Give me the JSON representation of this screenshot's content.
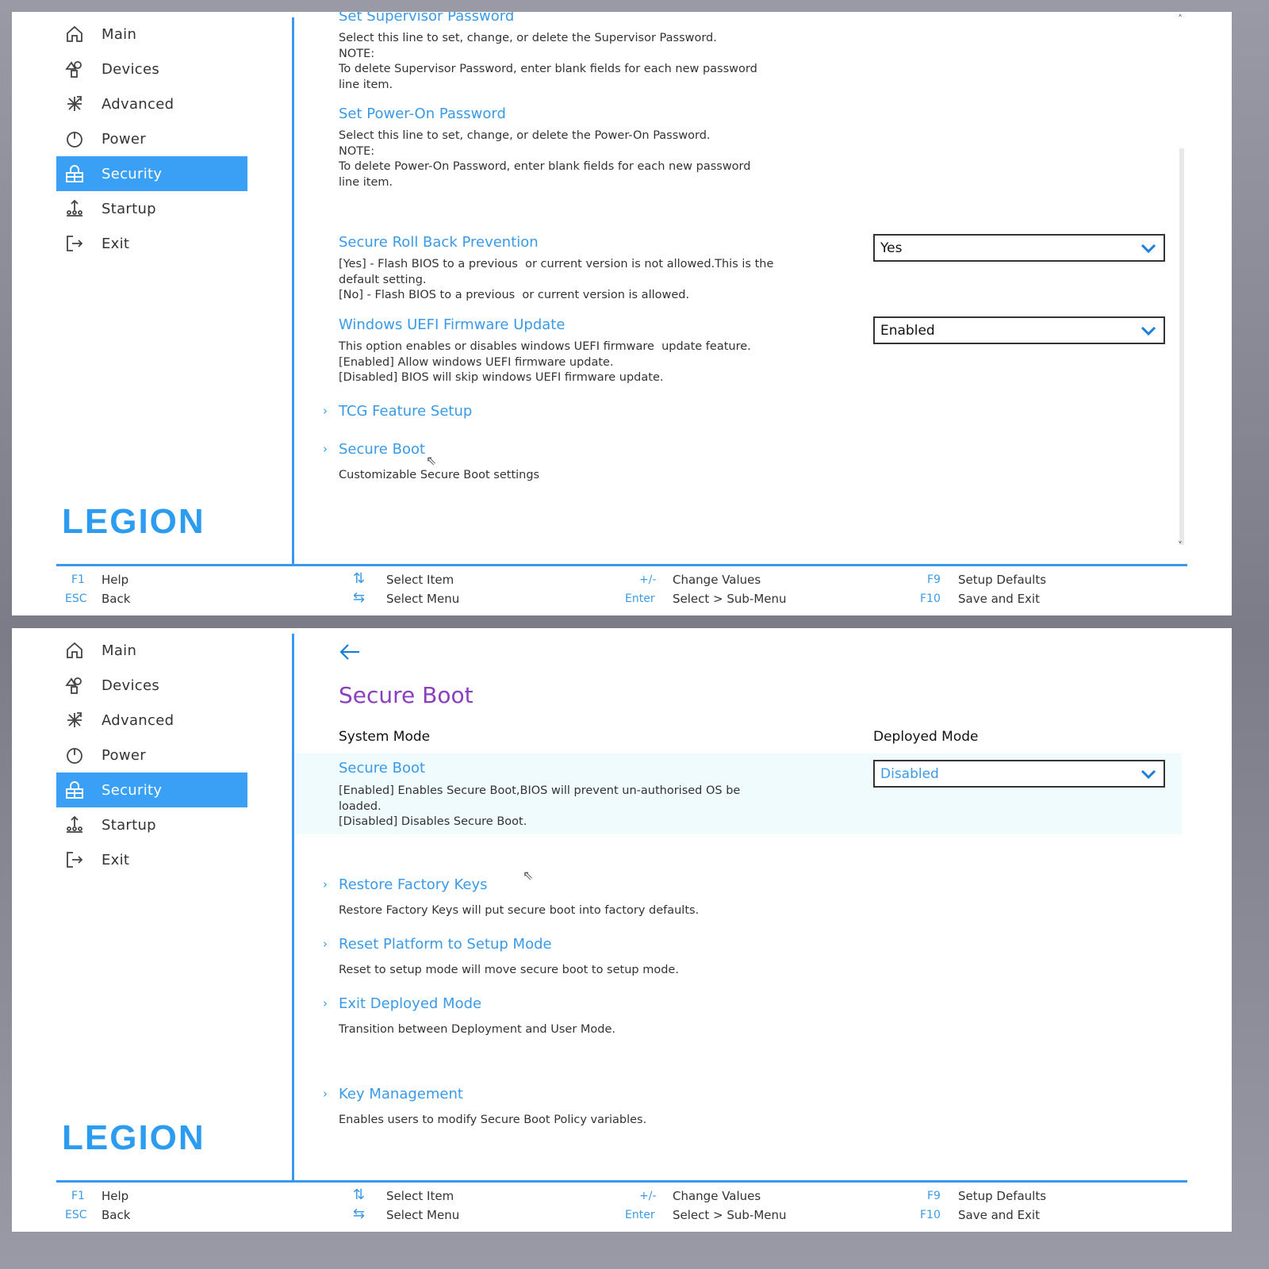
{
  "sidebar": {
    "items": [
      {
        "label": "Main",
        "icon": "home-icon"
      },
      {
        "label": "Devices",
        "icon": "devices-icon"
      },
      {
        "label": "Advanced",
        "icon": "advanced-icon"
      },
      {
        "label": "Power",
        "icon": "power-icon"
      },
      {
        "label": "Security",
        "icon": "lock-icon",
        "selected": true
      },
      {
        "label": "Startup",
        "icon": "startup-icon"
      },
      {
        "label": "Exit",
        "icon": "exit-icon"
      }
    ],
    "logo": "LEGION"
  },
  "footer": {
    "f1": "F1",
    "help": "Help",
    "esc": "ESC",
    "back": "Back",
    "select_item": "Select Item",
    "select_menu": "Select Menu",
    "plusminus": "+/-",
    "change_values": "Change Values",
    "enter": "Enter",
    "sub_menu": "Select > Sub-Menu",
    "f9": "F9",
    "defaults": "Setup Defaults",
    "f10": "F10",
    "save_exit": "Save and Exit"
  },
  "panel1": {
    "supervisor": {
      "title": "Set Supervisor Password",
      "desc": "Select this line to set, change, or delete the Supervisor Password.\nNOTE:\nTo delete Supervisor Password, enter blank fields for each new password\nline item."
    },
    "poweron": {
      "title": "Set Power-On Password",
      "desc": "Select this line to set, change, or delete the Power-On Password.\nNOTE:\nTo delete Power-On Password, enter blank fields for each new password\nline item."
    },
    "rollback": {
      "title": "Secure Roll Back Prevention",
      "desc": "[Yes] - Flash BIOS to a previous  or current version is not allowed.This is the\ndefault setting.\n[No] - Flash BIOS to a previous  or current version is allowed.",
      "value": "Yes"
    },
    "uefi": {
      "title": "Windows UEFI Firmware Update",
      "desc": "This option enables or disables windows UEFI firmware  update feature.\n[Enabled] Allow windows UEFI firmware update.\n[Disabled] BIOS will skip windows UEFI firmware update.",
      "value": "Enabled"
    },
    "tcg": {
      "title": "TCG Feature Setup"
    },
    "secureboot": {
      "title": "Secure Boot",
      "desc": "Customizable Secure Boot settings"
    }
  },
  "panel2": {
    "title": "Secure Boot",
    "system_mode_label": "System Mode",
    "system_mode_value": "Deployed Mode",
    "secureboot": {
      "title": "Secure Boot",
      "desc": "[Enabled] Enables Secure Boot,BIOS will prevent un-authorised OS be\nloaded.\n[Disabled] Disables Secure Boot.",
      "value": "Disabled"
    },
    "restore": {
      "title": "Restore Factory Keys",
      "desc": "Restore Factory Keys will put secure boot into factory defaults."
    },
    "reset": {
      "title": "Reset Platform to Setup Mode",
      "desc": "Reset to setup mode will move secure boot to setup mode."
    },
    "exitdeployed": {
      "title": "Exit Deployed Mode",
      "desc": "Transition between Deployment and User Mode."
    },
    "keymgmt": {
      "title": "Key Management",
      "desc": "Enables users to modify Secure Boot Policy variables."
    }
  },
  "colors": {
    "accent": "#3aa0f5",
    "title": "#8a3fc0",
    "link": "#3a9ae8"
  }
}
